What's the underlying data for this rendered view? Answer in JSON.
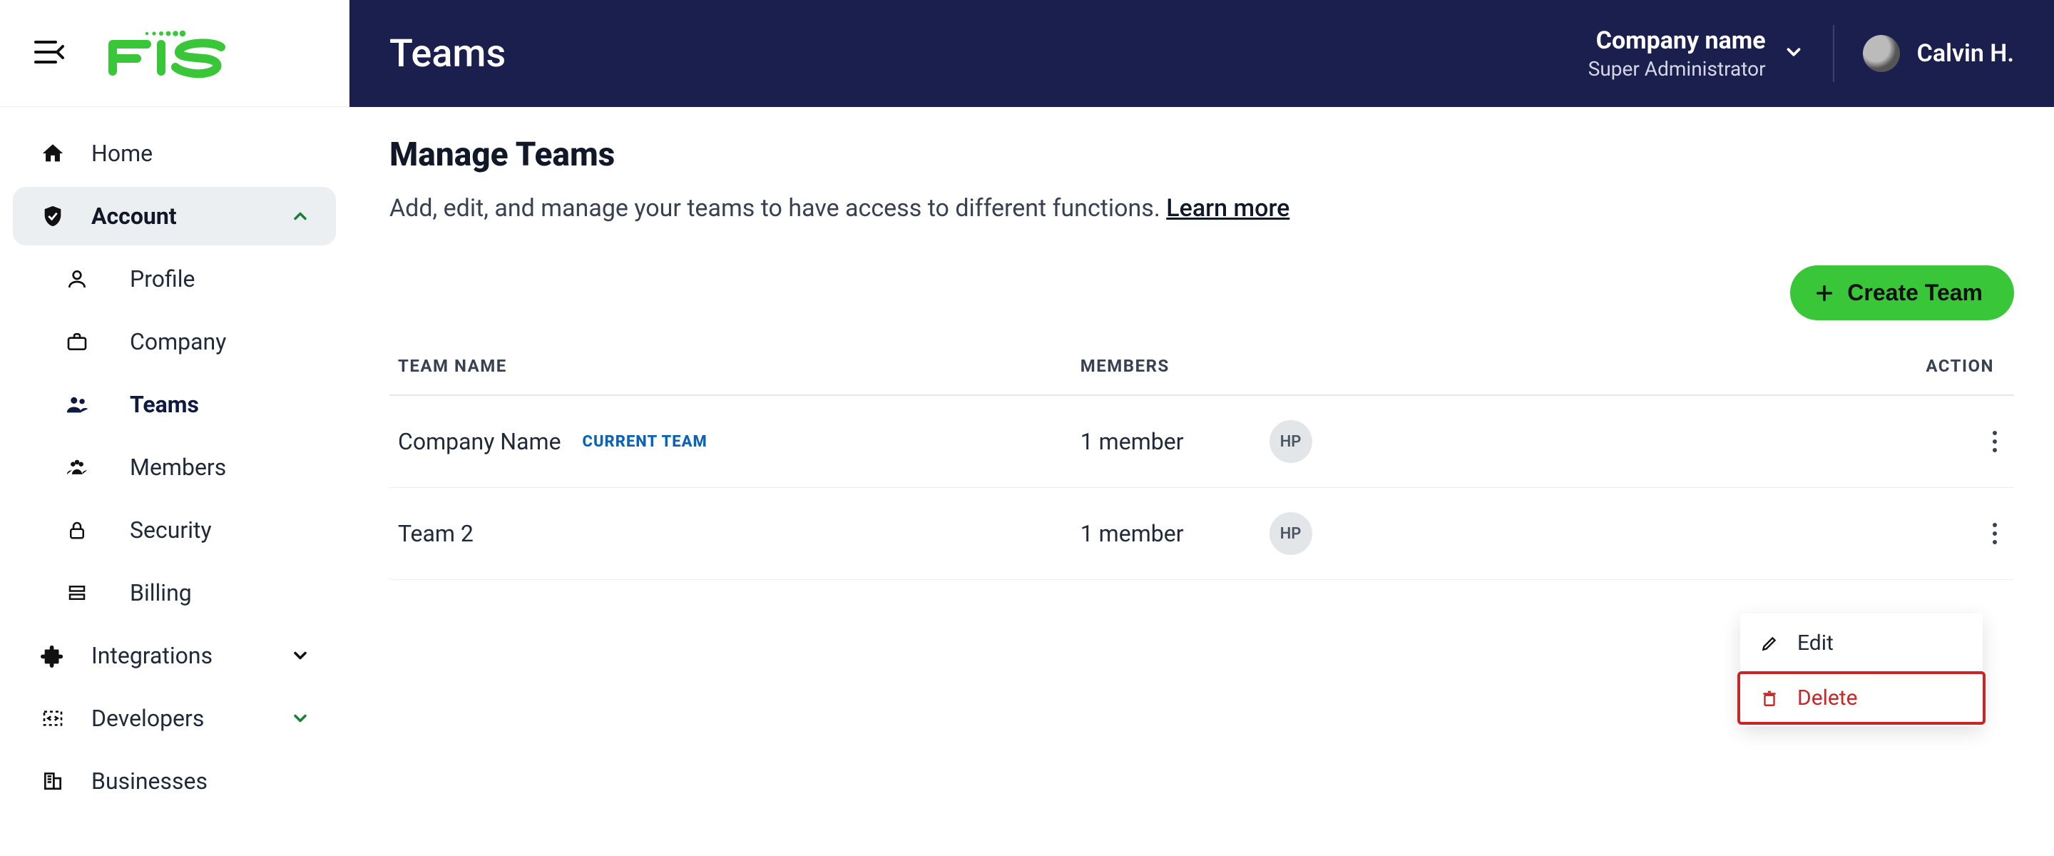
{
  "brand": {
    "name": "FIS"
  },
  "topbar": {
    "title": "Teams",
    "company_name": "Company name",
    "company_role": "Super Administrator",
    "user_name": "Calvin H."
  },
  "sidebar": {
    "items": [
      {
        "key": "home",
        "label": "Home",
        "icon": "home-icon"
      },
      {
        "key": "account",
        "label": "Account",
        "icon": "shield-check-icon",
        "expanded": true,
        "active": true,
        "children": [
          {
            "key": "profile",
            "label": "Profile",
            "icon": "person-icon"
          },
          {
            "key": "company",
            "label": "Company",
            "icon": "briefcase-icon"
          },
          {
            "key": "teams",
            "label": "Teams",
            "icon": "people-icon",
            "current": true
          },
          {
            "key": "members",
            "label": "Members",
            "icon": "group-icon"
          },
          {
            "key": "security",
            "label": "Security",
            "icon": "lock-icon"
          },
          {
            "key": "billing",
            "label": "Billing",
            "icon": "layers-icon"
          }
        ]
      },
      {
        "key": "integrations",
        "label": "Integrations",
        "icon": "puzzle-icon",
        "expandable": true
      },
      {
        "key": "developers",
        "label": "Developers",
        "icon": "code-box-icon",
        "expandable": true
      },
      {
        "key": "businesses",
        "label": "Businesses",
        "icon": "building-icon"
      }
    ]
  },
  "page": {
    "heading": "Manage Teams",
    "subtext": "Add, edit, and manage your teams to have access to different functions. ",
    "learn_more": "Learn more",
    "create_button": "Create Team"
  },
  "table": {
    "columns": {
      "team_name": "TEAM NAME",
      "members": "MEMBERS",
      "action": "ACTION"
    },
    "rows": [
      {
        "name": "Company Name",
        "current_badge": "CURRENT TEAM",
        "members_text": "1 member",
        "member_initials": "HP"
      },
      {
        "name": "Team 2",
        "current_badge": "",
        "members_text": "1 member",
        "member_initials": "HP"
      }
    ]
  },
  "row_menu": {
    "edit": "Edit",
    "delete": "Delete"
  },
  "colors": {
    "brand_green": "#39c639",
    "topbar_navy": "#1a1f4d",
    "danger": "#c62828",
    "badge_blue": "#0b63b3"
  }
}
